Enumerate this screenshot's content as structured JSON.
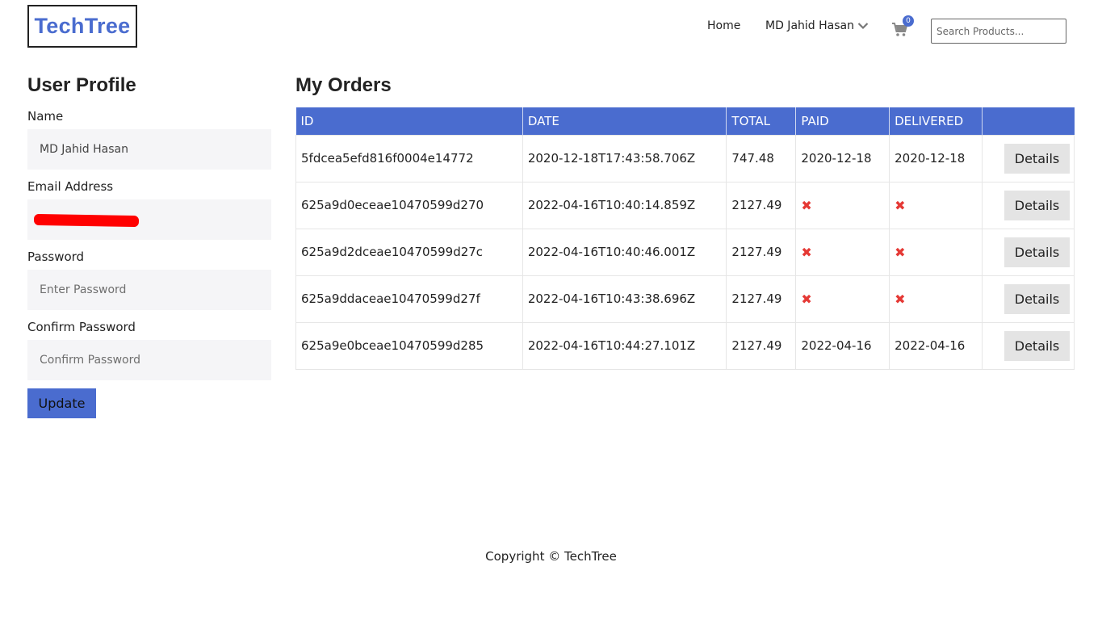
{
  "header": {
    "logo": "TechTree",
    "nav_home": "Home",
    "nav_user": "MD Jahid Hasan",
    "cart_count": "0",
    "search_placeholder": "Search Products..."
  },
  "profile": {
    "title": "User Profile",
    "name_label": "Name",
    "name_value": "MD Jahid Hasan",
    "email_label": "Email Address",
    "password_label": "Password",
    "password_placeholder": "Enter Password",
    "confirm_label": "Confirm Password",
    "confirm_placeholder": "Confirm Password",
    "update_label": "Update"
  },
  "orders": {
    "title": "My Orders",
    "columns": [
      "ID",
      "DATE",
      "TOTAL",
      "PAID",
      "DELIVERED",
      ""
    ],
    "rows": [
      {
        "id": "5fdcea5efd816f0004e14772",
        "date": "2020-12-18T17:43:58.706Z",
        "total": "747.48",
        "paid": "2020-12-18",
        "delivered": "2020-12-18",
        "action": "Details"
      },
      {
        "id": "625a9d0eceae10470599d270",
        "date": "2022-04-16T10:40:14.859Z",
        "total": "2127.49",
        "paid": "✖",
        "delivered": "✖",
        "action": "Details"
      },
      {
        "id": "625a9d2dceae10470599d27c",
        "date": "2022-04-16T10:40:46.001Z",
        "total": "2127.49",
        "paid": "✖",
        "delivered": "✖",
        "action": "Details"
      },
      {
        "id": "625a9ddaceae10470599d27f",
        "date": "2022-04-16T10:43:38.696Z",
        "total": "2127.49",
        "paid": "✖",
        "delivered": "✖",
        "action": "Details"
      },
      {
        "id": "625a9e0bceae10470599d285",
        "date": "2022-04-16T10:44:27.101Z",
        "total": "2127.49",
        "paid": "2022-04-16",
        "delivered": "2022-04-16",
        "action": "Details"
      }
    ]
  },
  "footer": {
    "copyright": "Copyright © TechTree"
  },
  "colors": {
    "accent": "#4a6ccf",
    "not_paid_mark": "#e53935",
    "redaction": "#ff0000"
  }
}
